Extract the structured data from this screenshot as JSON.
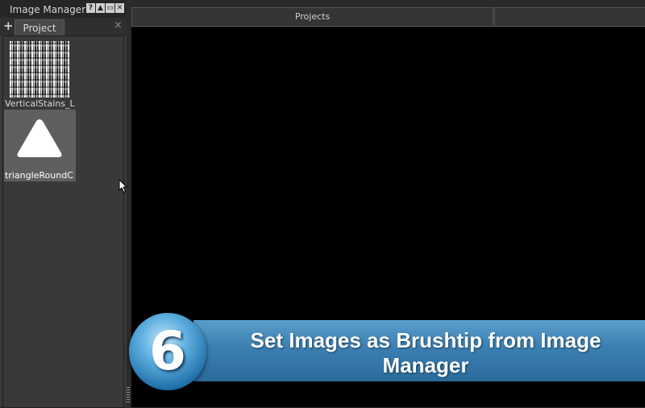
{
  "window": {
    "panel_title": "Image Manager",
    "title_buttons": [
      "?",
      "▲",
      "▭",
      "✕"
    ]
  },
  "panel": {
    "add_label": "+",
    "tab_label": "Project",
    "tab_close": "×",
    "items": [
      {
        "label": "VerticalStains_L",
        "icon": "vertical-stains-thumbnail"
      },
      {
        "label": "triangleRoundC",
        "icon": "triangle-thumbnail"
      }
    ]
  },
  "main": {
    "columns": [
      "Projects",
      ""
    ]
  },
  "banner": {
    "step_number": "6",
    "text": "Set Images as Brushtip from Image Manager",
    "color": "#3b7fb1"
  }
}
